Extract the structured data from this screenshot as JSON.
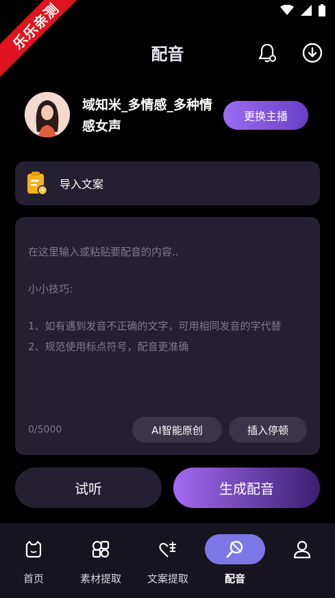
{
  "status_bar": {
    "ribbon_text": "乐乐亲测"
  },
  "header": {
    "title": "配音"
  },
  "voice": {
    "name": "域知米_多情感_多种情感女声",
    "change_label": "更换主播"
  },
  "import": {
    "label": "导入文案"
  },
  "editor": {
    "placeholder_lines": [
      "在这里输入或粘贴要配音的内容..",
      "小小技巧:",
      "1、如有遇到发音不正确的文字，可用相同发音的字代替",
      "2、规范使用标点符号，配音更准确"
    ],
    "char_count": "0/5000",
    "ai_label": "AI智能原创",
    "pause_label": "插入停顿"
  },
  "actions": {
    "listen_label": "试听",
    "generate_label": "生成配音"
  },
  "tabs": [
    {
      "label": "首页",
      "icon": "home-icon",
      "active": false
    },
    {
      "label": "素材提取",
      "icon": "material-icon",
      "active": false
    },
    {
      "label": "文案提取",
      "icon": "copy-extract-icon",
      "active": false
    },
    {
      "label": "配音",
      "icon": "dubbing-icon",
      "active": true
    },
    {
      "label": "",
      "icon": "profile-icon",
      "active": false
    }
  ],
  "colors": {
    "accent": "#9b6cf0",
    "tab_active": "#7d76e6",
    "card": "#242031"
  }
}
